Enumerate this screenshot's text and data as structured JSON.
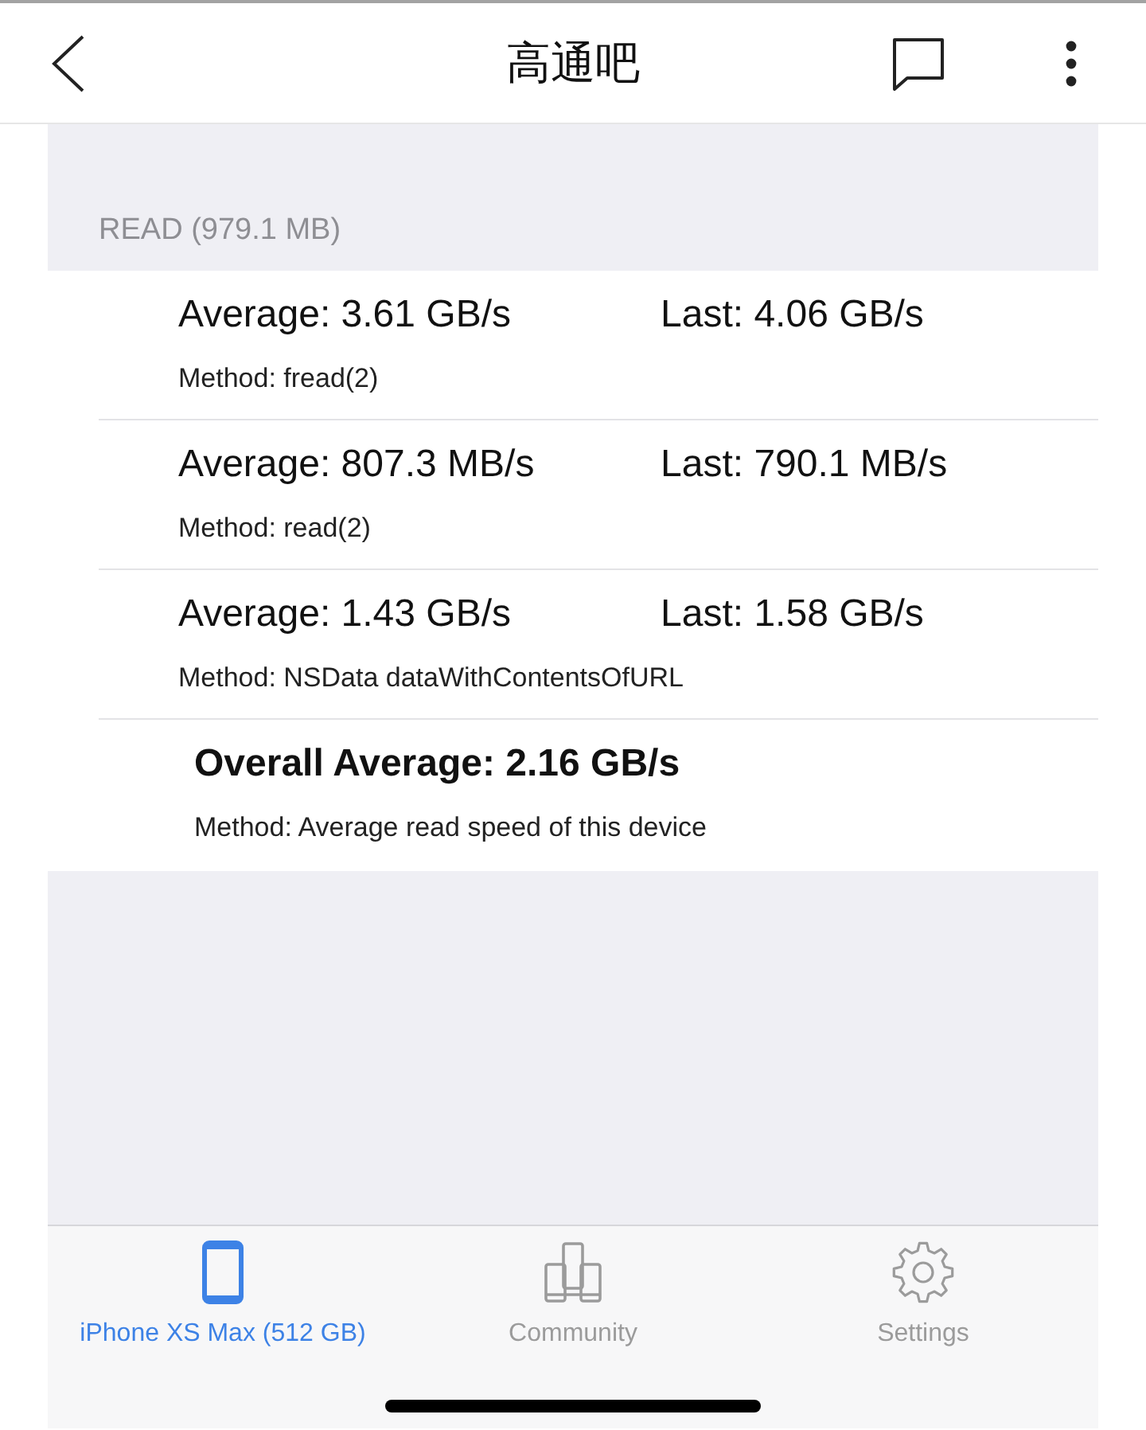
{
  "header": {
    "title": "高通吧"
  },
  "section": {
    "title": "READ (979.1 MB)"
  },
  "results": [
    {
      "kind": "method",
      "average": "Average: 3.61 GB/s",
      "last": "Last: 4.06 GB/s",
      "method": "Method: fread(2)"
    },
    {
      "kind": "method",
      "average": "Average: 807.3 MB/s",
      "last": "Last: 790.1 MB/s",
      "method": "Method: read(2)"
    },
    {
      "kind": "method",
      "average": "Average: 1.43 GB/s",
      "last": "Last: 1.58 GB/s",
      "method": "Method: NSData dataWithContentsOfURL"
    },
    {
      "kind": "overall",
      "average": "Overall Average: 2.16 GB/s",
      "method": "Method: Average read speed of this device"
    }
  ],
  "tab_bar": [
    {
      "kind": "device",
      "label": "iPhone XS Max (512 GB)",
      "selected": true
    },
    {
      "kind": "community",
      "label": "Community",
      "selected": false
    },
    {
      "kind": "settings",
      "label": "Settings",
      "selected": false
    }
  ]
}
